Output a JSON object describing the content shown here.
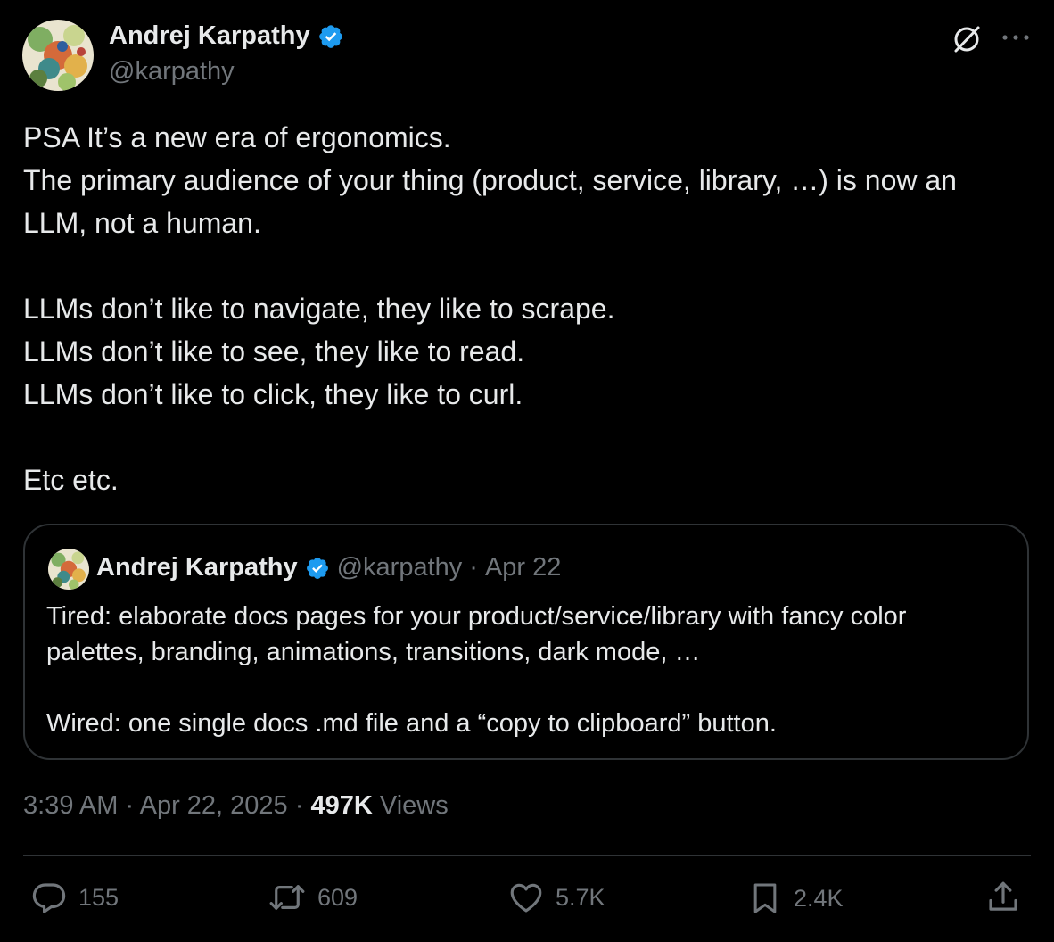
{
  "author": {
    "name": "Andrej Karpathy",
    "handle": "@karpathy",
    "verified": true,
    "verified_color": "#1d9bf0"
  },
  "header_actions": {
    "grok_icon": "grok-icon",
    "more_icon": "more-icon"
  },
  "tweet": {
    "lines": [
      "PSA It’s a new era of ergonomics.",
      "The primary audience of your thing (product, service, library, …) is now an",
      "LLM, not a human.",
      "",
      "LLMs don’t like to navigate, they like to scrape.",
      "LLMs don’t like to see, they like to read.",
      "LLMs don’t like to click, they like to curl.",
      "",
      "Etc etc."
    ]
  },
  "quote": {
    "name": "Andrej Karpathy",
    "handle": "@karpathy",
    "separator": "·",
    "date": "Apr 22",
    "lines": [
      "Tired: elaborate docs pages for your product/service/library with fancy color",
      "palettes, branding, animations, transitions, dark mode, …",
      "",
      "Wired: one single docs .md file and a “copy to clipboard” button."
    ]
  },
  "meta": {
    "time": "3:39 AM",
    "separator": "·",
    "date": "Apr 22, 2025",
    "views_count": "497K",
    "views_label": "Views"
  },
  "actions": {
    "replies": "155",
    "reposts": "609",
    "likes": "5.7K",
    "bookmarks": "2.4K"
  },
  "colors": {
    "background": "#000000",
    "text": "#e7e9ea",
    "muted": "#71767b",
    "border": "#2f3336",
    "accent": "#1d9bf0"
  }
}
